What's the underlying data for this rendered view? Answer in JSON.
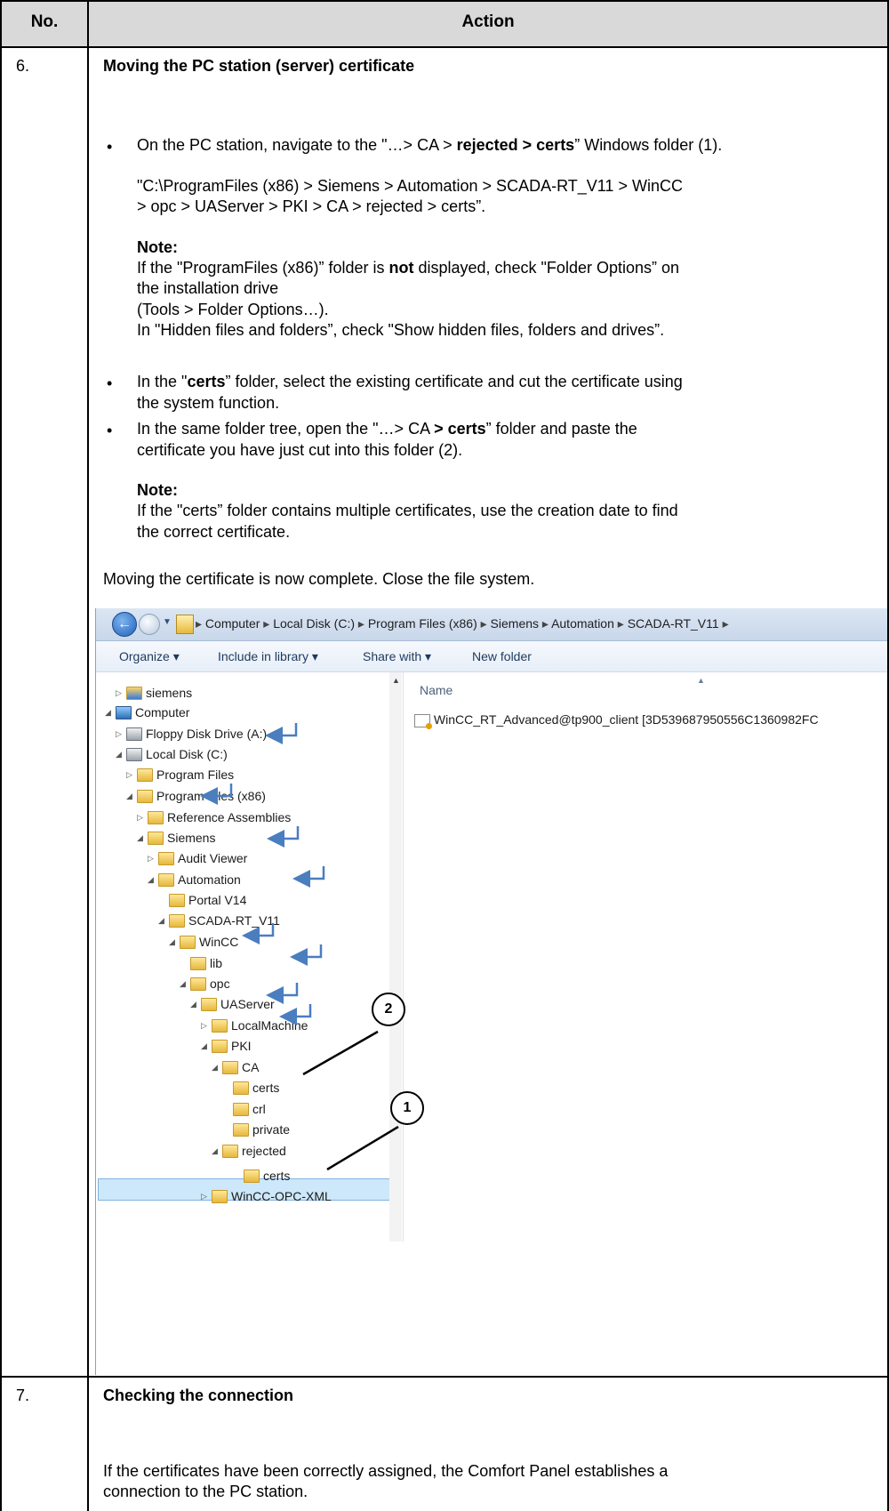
{
  "header": {
    "col_no": "No.",
    "col_action": "Action"
  },
  "step6": {
    "number": "6.",
    "title": "Moving the PC station (server) certificate",
    "bullet1_part1": "On the PC station, navigate to the \"…> CA > ",
    "bullet1_bold": "rejected > certs",
    "bullet1_part2": "” Windows folder (1).",
    "bullet1_path_line1": "\"C:\\ProgramFiles (x86) > Siemens > Automation > SCADA-RT_V11 > WinCC",
    "bullet1_path_line2": "> opc > UAServer > PKI > CA > rejected > certs”.",
    "note1_label": "Note:",
    "note1_line1_a": "If the \"ProgramFiles (x86)” folder is ",
    "note1_line1_bold": "not",
    "note1_line1_b": " displayed, check \"Folder Options” on",
    "note1_line2": "the installation drive",
    "note1_line3": "(Tools > Folder Options…).",
    "note1_line4": "In \"Hidden files and folders”, check \"Show hidden files, folders and drives”.",
    "bullet2_a": "In the \"",
    "bullet2_bold": "certs",
    "bullet2_b": "” folder, select the existing certificate and cut the certificate using",
    "bullet2_line2": "the system function.",
    "bullet3_a": "In the same folder tree, open the \"…> CA ",
    "bullet3_bold": "> certs",
    "bullet3_b": "” folder and paste the",
    "bullet3_line2": "certificate you have just cut into this folder (2).",
    "note2_label": "Note:",
    "note2_line1": "If the \"certs” folder contains multiple certificates, use the creation date to find",
    "note2_line2": "the correct certificate.",
    "closing": "Moving the certificate is now complete. Close the file system."
  },
  "explorer": {
    "breadcrumb": [
      "Computer",
      "Local Disk (C:)",
      "Program Files (x86)",
      "Siemens",
      "Automation",
      "SCADA-RT_V11"
    ],
    "toolbar": [
      "Organize ▾",
      "Include in library ▾",
      "Share with ▾",
      "New folder"
    ],
    "tree": [
      {
        "label": "siemens",
        "icon": "siemens-user-folder-icon"
      },
      {
        "label": "Computer",
        "icon": "computer-icon"
      },
      {
        "label": "Floppy Disk Drive (A:)",
        "icon": "floppy-drive-icon"
      },
      {
        "label": "Local Disk (C:)",
        "icon": "local-disk-icon"
      },
      {
        "label": "Program Files",
        "icon": "folder-icon"
      },
      {
        "label": "Program Files (x86)",
        "icon": "folder-icon"
      },
      {
        "label": "Reference Assemblies",
        "icon": "folder-icon"
      },
      {
        "label": "Siemens",
        "icon": "folder-icon"
      },
      {
        "label": "Audit Viewer",
        "icon": "folder-icon"
      },
      {
        "label": "Automation",
        "icon": "folder-icon"
      },
      {
        "label": "Portal V14",
        "icon": "folder-icon"
      },
      {
        "label": "SCADA-RT_V11",
        "icon": "folder-icon"
      },
      {
        "label": "WinCC",
        "icon": "folder-icon"
      },
      {
        "label": "lib",
        "icon": "folder-icon"
      },
      {
        "label": "opc",
        "icon": "folder-icon"
      },
      {
        "label": "UAServer",
        "icon": "folder-icon"
      },
      {
        "label": "LocalMachine",
        "icon": "folder-icon"
      },
      {
        "label": "PKI",
        "icon": "folder-icon"
      },
      {
        "label": "CA",
        "icon": "folder-icon"
      },
      {
        "label": "certs",
        "icon": "folder-icon"
      },
      {
        "label": "crl",
        "icon": "folder-icon"
      },
      {
        "label": "private",
        "icon": "folder-icon"
      },
      {
        "label": "rejected",
        "icon": "folder-icon"
      },
      {
        "label": "certs",
        "icon": "folder-icon"
      },
      {
        "label": "WinCC-OPC-XML",
        "icon": "folder-icon"
      }
    ],
    "column_name": "Name",
    "file_name": "WinCC_RT_Advanced@tp900_client [3D539687950556C1360982FC",
    "callout_1": "1",
    "callout_2": "2"
  },
  "step7": {
    "number": "7.",
    "title": "Checking the connection",
    "line1": "If the certificates have been correctly assigned, the Comfort Panel establishes a",
    "line2": "connection to the PC station."
  }
}
